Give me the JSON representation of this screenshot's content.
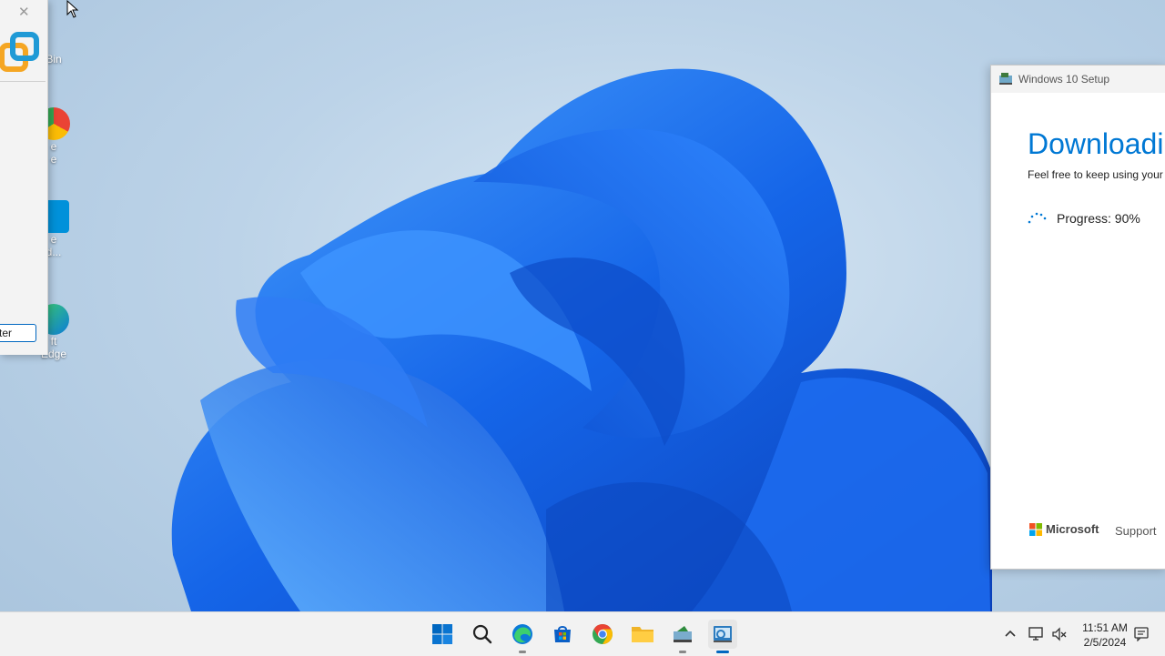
{
  "desktop": {
    "icons": [
      {
        "label": "Bin",
        "icon": "recycle-bin-icon"
      },
      {
        "label": "e\ne",
        "icon": "chrome-icon"
      },
      {
        "label": "e\nd...",
        "icon": "vmware-icon"
      },
      {
        "label": "ft\nEdge",
        "icon": "edge-icon"
      }
    ]
  },
  "left_window": {
    "close_label": "✕",
    "input_value": "ter"
  },
  "setup": {
    "title": "Windows 10 Setup",
    "heading": "Downloadin",
    "subtitle": "Feel free to keep using your P",
    "progress": "Progress: 90%",
    "progress_value": 0.9,
    "brand": "Microsoft",
    "support": "Support"
  },
  "taskbar": {
    "apps": [
      "start-button",
      "search-button",
      "edge-button",
      "store-button",
      "chrome-button",
      "file-explorer-button",
      "media-creation-tool-button",
      "windows-setup-button"
    ],
    "tray_chevron": "^",
    "time": "11:51 AM",
    "date": "2/5/2024"
  },
  "colors": {
    "accent": "#0078d4",
    "bloom": "#1a6ff2",
    "taskbar": "#f2f2f2"
  }
}
